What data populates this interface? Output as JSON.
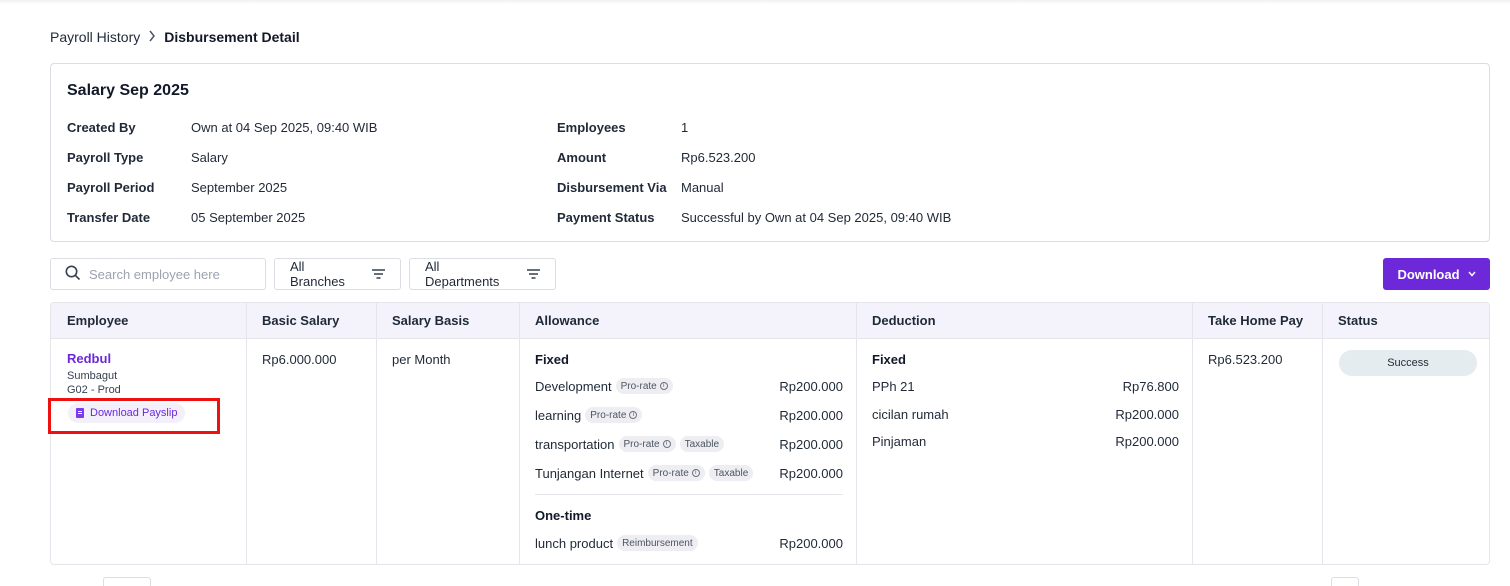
{
  "breadcrumb": {
    "parent": "Payroll History",
    "separator": ">",
    "current": "Disbursement Detail"
  },
  "summary": {
    "title": "Salary Sep 2025",
    "left": [
      {
        "label": "Created By",
        "value": "Own at 04 Sep 2025, 09:40 WIB"
      },
      {
        "label": "Payroll Type",
        "value": "Salary"
      },
      {
        "label": "Payroll Period",
        "value": "September 2025"
      },
      {
        "label": "Transfer Date",
        "value": "05 September 2025"
      }
    ],
    "right": [
      {
        "label": "Employees",
        "value": "1"
      },
      {
        "label": "Amount",
        "value": "Rp6.523.200"
      },
      {
        "label": "Disbursement Via",
        "value": "Manual"
      },
      {
        "label": "Payment Status",
        "value": "Successful by Own at 04 Sep 2025, 09:40 WIB"
      }
    ]
  },
  "toolbar": {
    "search_placeholder": "Search employee here",
    "branches_label": "All Branches",
    "departments_label": "All Departments",
    "download_label": "Download",
    "icons": {
      "search": "search-icon",
      "filter": "filter-icon",
      "chevron": "chevron-down-icon"
    }
  },
  "table": {
    "headers": [
      "Employee",
      "Basic Salary",
      "Salary Basis",
      "Allowance",
      "Deduction",
      "Take Home Pay",
      "Status"
    ],
    "row": {
      "employee": {
        "name": "Redbul",
        "branch": "Sumbagut",
        "department": "G02 - Prod",
        "payslip_label": "Download Payslip"
      },
      "basic_salary": "Rp6.000.000",
      "salary_basis": "per Month",
      "allowance": {
        "fixed_title": "Fixed",
        "fixed_items": [
          {
            "name": "Development",
            "tags": [
              "Pro-rate"
            ],
            "value": "Rp200.000"
          },
          {
            "name": "learning",
            "tags": [
              "Pro-rate"
            ],
            "value": "Rp200.000"
          },
          {
            "name": "transportation",
            "tags": [
              "Pro-rate",
              "Taxable"
            ],
            "value": "Rp200.000"
          },
          {
            "name": "Tunjangan Internet",
            "tags": [
              "Pro-rate",
              "Taxable"
            ],
            "value": "Rp200.000"
          }
        ],
        "onetime_title": "One-time",
        "onetime_items": [
          {
            "name": "lunch product",
            "tags": [
              "Reimbursement"
            ],
            "value": "Rp200.000"
          }
        ]
      },
      "deduction": {
        "fixed_title": "Fixed",
        "items": [
          {
            "name": "PPh 21",
            "value": "Rp76.800"
          },
          {
            "name": "cicilan rumah",
            "value": "Rp200.000"
          },
          {
            "name": "Pinjaman",
            "value": "Rp200.000"
          }
        ]
      },
      "take_home_pay": "Rp6.523.200",
      "status": "Success"
    }
  },
  "colors": {
    "accent": "#6d28d9",
    "header_bg": "#f4f3fc",
    "status_bg": "#e4ecef",
    "highlight": "#ee1111"
  }
}
